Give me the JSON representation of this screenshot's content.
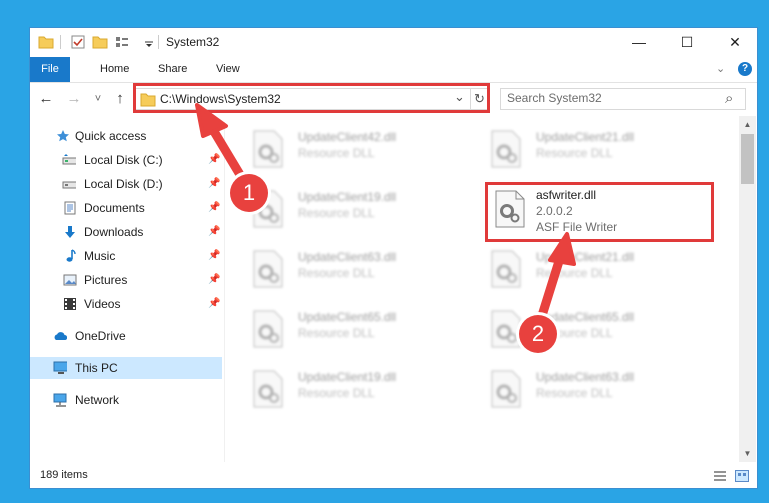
{
  "window": {
    "title": "System32",
    "controls": {
      "minimize": "—",
      "maximize": "☐",
      "close": "✕"
    }
  },
  "ribbon": {
    "tabs": [
      "File",
      "Home",
      "Share",
      "View"
    ],
    "chevron": "⌄",
    "help": "?"
  },
  "nav": {
    "back": "←",
    "forward": "→",
    "recent": "˅",
    "up": "↑",
    "address": "C:\\Windows\\System32",
    "address_dropdown": "⌄",
    "refresh": "↻",
    "search_placeholder": "Search System32",
    "search_icon": "⌕"
  },
  "sidebar": {
    "items": [
      {
        "label": "Quick access",
        "icon": "star-icon",
        "pinned": false
      },
      {
        "label": "Local Disk (C:)",
        "icon": "drive-icon",
        "pinned": true
      },
      {
        "label": "Local Disk (D:)",
        "icon": "drive-icon",
        "pinned": true
      },
      {
        "label": "Documents",
        "icon": "documents-icon",
        "pinned": true
      },
      {
        "label": "Downloads",
        "icon": "downloads-icon",
        "pinned": true
      },
      {
        "label": "Music",
        "icon": "music-icon",
        "pinned": true
      },
      {
        "label": "Pictures",
        "icon": "pictures-icon",
        "pinned": true
      },
      {
        "label": "Videos",
        "icon": "videos-icon",
        "pinned": true
      },
      {
        "label": "OneDrive",
        "icon": "onedrive-icon",
        "pinned": false
      },
      {
        "label": "This PC",
        "icon": "pc-icon",
        "pinned": false,
        "selected": true
      },
      {
        "label": "Network",
        "icon": "network-icon",
        "pinned": false
      }
    ],
    "pin_glyph": "📌"
  },
  "files": [
    {
      "name": "UpdateClient42.dll",
      "type": "Resource DLL",
      "blurred": true
    },
    {
      "name": "UpdateClient21.dll",
      "type": "Resource DLL",
      "blurred": true
    },
    {
      "name": "UpdateClient19.dll",
      "type": "Resource DLL",
      "blurred": true
    },
    {
      "name": "asfwriter.dll",
      "version": "2.0.0.2",
      "description": "ASF File Writer",
      "blurred": false
    },
    {
      "name": "UpdateClient63.dll",
      "type": "Resource DLL",
      "blurred": true
    },
    {
      "name": "UpdateClient21.dll",
      "type": "Resource DLL",
      "blurred": true
    },
    {
      "name": "UpdateClient65.dll",
      "type": "Resource DLL",
      "blurred": true
    },
    {
      "name": "UpdateClient65.dll",
      "type": "Resource DLL",
      "blurred": true
    },
    {
      "name": "UpdateClient19.dll",
      "type": "Resource DLL",
      "blurred": true
    },
    {
      "name": "UpdateClient63.dll",
      "type": "Resource DLL",
      "blurred": true
    }
  ],
  "status": {
    "item_count": "189 items"
  },
  "annotations": {
    "step1": "1",
    "step2": "2"
  },
  "colors": {
    "accent": "#1979ca",
    "annotation_red": "#e03a3a",
    "background": "#2aa4e5",
    "selected": "#cce8ff"
  }
}
